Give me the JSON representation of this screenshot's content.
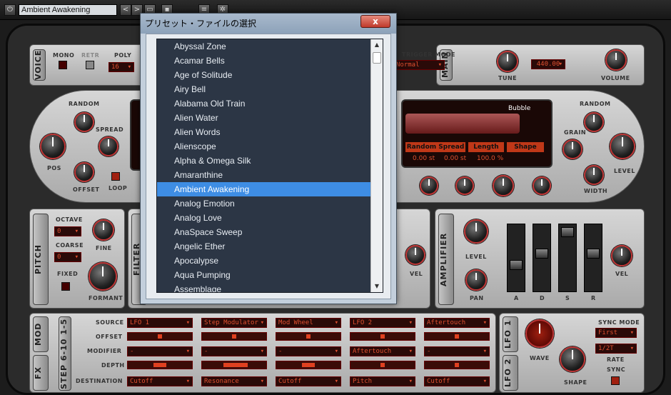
{
  "topbar": {
    "power_icon": "power-icon",
    "preset_name": "Ambient Awakening",
    "prev_label": "<",
    "next_label": ">",
    "folder_icon": "folder-icon",
    "save_icon": "save-icon",
    "compare_icon": "compare-icon",
    "settings_icon": "gear-icon"
  },
  "voice": {
    "tab": "VOICE",
    "mono": "MONO",
    "retr": "RETR",
    "poly": "POLY",
    "poly_value": "16",
    "random": "RANDOM",
    "spread": "SPREAD",
    "pos": "POS",
    "offset": "OFFSET",
    "loop": "LOOP"
  },
  "trigger": {
    "label": "TRIGGER MODE",
    "value": "Normal"
  },
  "main": {
    "tab": "MAIN",
    "tune": "TUNE",
    "tune_value": "440.00",
    "volume": "VOLUME"
  },
  "grain": {
    "random": "RANDOM",
    "grain": "GRAIN",
    "level": "LEVEL",
    "width": "WIDTH",
    "shape_name": "Bubble",
    "headers": [
      "Random Spread",
      "Length",
      "Shape"
    ],
    "values": [
      "0.00 st",
      "0.00 st",
      "100.0 %"
    ]
  },
  "pitch": {
    "tab": "PITCH",
    "octave": "OCTAVE",
    "octave_value": "0",
    "coarse": "COARSE",
    "coarse_value": "0",
    "fine": "FINE",
    "fixed": "FIXED",
    "formant": "FORMANT"
  },
  "filter": {
    "tab": "FILTER",
    "vel": "VEL"
  },
  "amplifier": {
    "tab": "AMPLIFIER",
    "level": "LEVEL",
    "pan": "PAN",
    "vel": "VEL",
    "adsr": [
      "A",
      "D",
      "S",
      "R"
    ]
  },
  "mod": {
    "tabs": [
      "MOD",
      "FX"
    ],
    "step_tabs": [
      "STEP",
      "6-10",
      "1-5"
    ],
    "row_labels": [
      "SOURCE",
      "OFFSET",
      "MODIFIER",
      "DEPTH",
      "DESTINATION"
    ],
    "sources": [
      "LFO 1",
      "Step Modulator",
      "Mod Wheel",
      "LFO 2",
      "Aftertouch"
    ],
    "modifiers": [
      "-",
      "-",
      "-",
      "Aftertouch",
      "-"
    ],
    "destinations": [
      "Cutoff",
      "Resonance",
      "Cutoff",
      "Pitch",
      "Cutoff"
    ]
  },
  "lfo": {
    "tabs": [
      "LFO 1",
      "LFO 2"
    ],
    "wave": "WAVE",
    "shape": "SHAPE",
    "sync_mode": "SYNC MODE",
    "sync_mode_value": "First",
    "rate": "RATE",
    "rate_value": "1/2T",
    "sync": "SYNC"
  },
  "dialog": {
    "title": "プリセット・ファイルの選択",
    "close_label": "x",
    "items": [
      "Abyssal Zone",
      "Acamar Bells",
      "Age of Solitude",
      "Airy Bell",
      "Alabama Old Train",
      "Alien Water",
      "Alien Words",
      "Alienscope",
      "Alpha & Omega Silk",
      "Amaranthine",
      "Ambient Awakening",
      "Analog Emotion",
      "Analog Love",
      "AnaSpace Sweep",
      "Angelic Ether",
      "Apocalypse",
      "Aqua Pumping",
      "Assemblage"
    ],
    "selected": "Ambient Awakening"
  }
}
